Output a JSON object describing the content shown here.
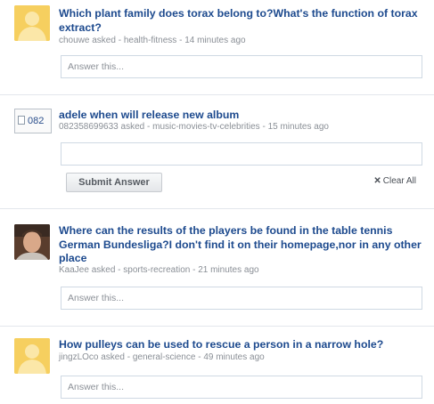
{
  "questions": [
    {
      "title": "Which plant family does torax belong to?What's the function of torax extract?",
      "user": "chouwe",
      "asked_label": "asked -",
      "category": "health-fitness",
      "time": "- 14 minutes ago",
      "answer_placeholder": "Answer this...",
      "avatar": "default-avatar-icon"
    },
    {
      "title": "adele when will release new album",
      "user": "082358699633",
      "asked_label": "asked -",
      "category": "music-movies-tv-celebrities",
      "time": "- 15 minutes ago",
      "avatar_text": "082",
      "avatar": "document-icon",
      "submit_label": "Submit Answer",
      "clear_label": "Clear All",
      "clear_icon": "x-icon"
    },
    {
      "title": "Where can the results of the players be found in the table tennis German Bundesliga?I don't find it on their homepage,nor in any other place",
      "user": "KaaJee",
      "asked_label": "asked -",
      "category": "sports-recreation",
      "time": "- 21 minutes ago",
      "answer_placeholder": "Answer this...",
      "avatar": "user-photo"
    },
    {
      "title": "How pulleys can be used to rescue a person in a narrow hole?",
      "user": "jingzLOco",
      "asked_label": "asked -",
      "category": "general-science",
      "time": "- 49 minutes ago",
      "answer_placeholder": "Answer this...",
      "avatar": "default-avatar-icon"
    }
  ],
  "colors": {
    "link": "#1d4a8e",
    "meta": "#8a8f96",
    "avatar_default": "#f6cf5f"
  }
}
